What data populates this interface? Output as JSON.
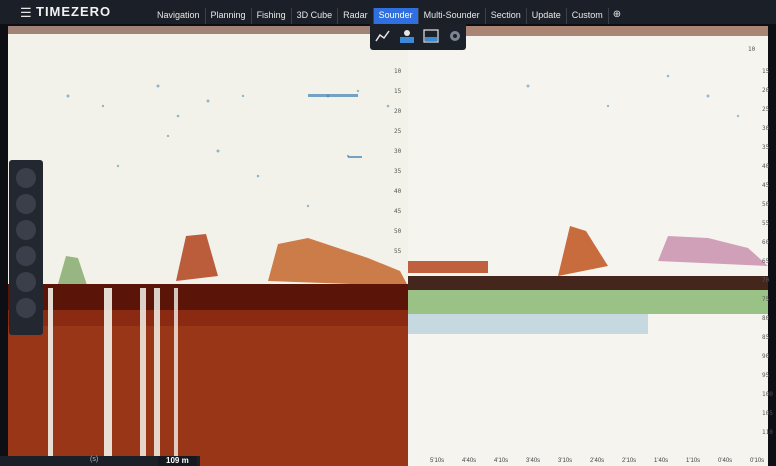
{
  "app": {
    "brand": "TIMEZERO"
  },
  "tabs": [
    {
      "label": "Navigation"
    },
    {
      "label": "Planning"
    },
    {
      "label": "Fishing"
    },
    {
      "label": "3D Cube"
    },
    {
      "label": "Radar"
    },
    {
      "label": "Sounder"
    },
    {
      "label": "Multi-Sounder"
    },
    {
      "label": "Section"
    },
    {
      "label": "Update"
    },
    {
      "label": "Custom"
    }
  ],
  "active_tab": "Sounder",
  "colors": {
    "accent": "#2f6fe0",
    "bottom_echo": "#7a1a0c",
    "background_echo": "#f3f2ea"
  },
  "sounder": {
    "range": "109 m",
    "depth_labels_left": [
      "10",
      "15",
      "20",
      "25",
      "30",
      "35",
      "40",
      "45",
      "50",
      "55"
    ],
    "depth_labels_right": [
      "10",
      "15",
      "20",
      "25",
      "30",
      "35",
      "40",
      "45",
      "50",
      "55",
      "60",
      "65",
      "70",
      "75",
      "80",
      "85",
      "90",
      "95",
      "100",
      "105",
      "110"
    ],
    "time_labels": [
      "5'10s",
      "4'40s",
      "4'10s",
      "3'40s",
      "3'10s",
      "2'40s",
      "2'10s",
      "1'40s",
      "1'10s",
      "0'40s",
      "0'10s"
    ],
    "bottom_left_label": "(s)"
  }
}
